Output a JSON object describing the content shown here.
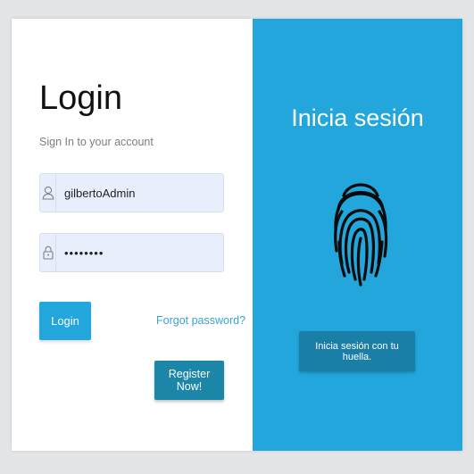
{
  "login": {
    "title": "Login",
    "subtitle": "Sign In to your account",
    "username_value": "gilbertoAdmin",
    "password_value": "••••••••",
    "login_button": "Login",
    "forgot_link": "Forgot password?",
    "register_button": "Register Now!"
  },
  "fingerprint_panel": {
    "title": "Inicia sesión",
    "button": "Inicia sesión con tu huella.",
    "icon": "fingerprint-icon"
  },
  "icons": {
    "user": "user-icon",
    "lock": "lock-icon"
  },
  "colors": {
    "accent": "#22a6dc",
    "accent_dark": "#1b86a8",
    "input_bg": "#e8eefc",
    "page_bg": "#e4e5e7"
  }
}
